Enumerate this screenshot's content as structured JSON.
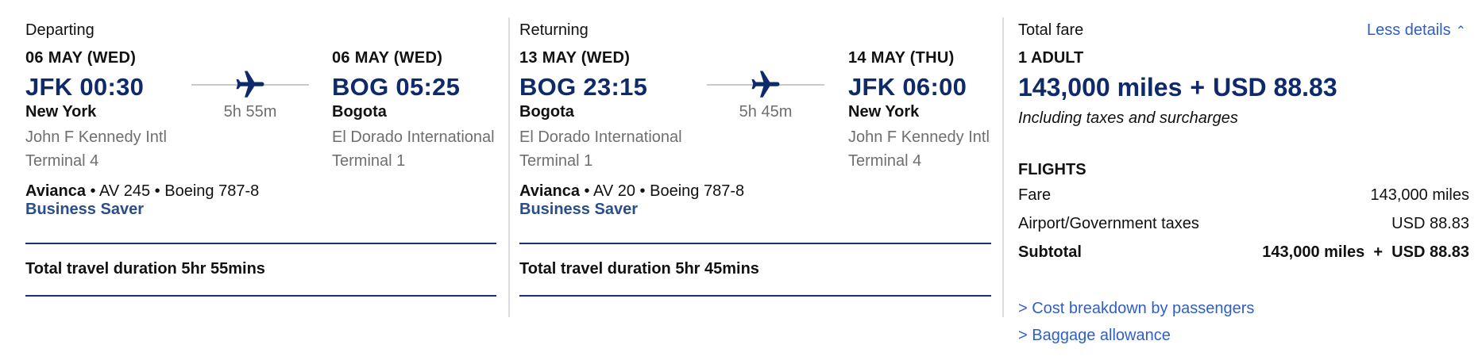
{
  "departing": {
    "section_label": "Departing",
    "from": {
      "date": "06 MAY (WED)",
      "time": "JFK 00:30",
      "city": "New York",
      "airport": "John F Kennedy Intl",
      "terminal": "Terminal 4"
    },
    "to": {
      "date": "06 MAY (WED)",
      "time": "BOG 05:25",
      "city": "Bogota",
      "airport": "El Dorado International",
      "terminal": "Terminal 1"
    },
    "duration": "5h 55m",
    "airline": "Avianca",
    "flight_details": "AV 245 • Boeing 787-8",
    "fare_class": "Business Saver",
    "total_duration": "Total travel duration 5hr 55mins"
  },
  "returning": {
    "section_label": "Returning",
    "from": {
      "date": "13 MAY (WED)",
      "time": "BOG 23:15",
      "city": "Bogota",
      "airport": "El Dorado International",
      "terminal": "Terminal 1"
    },
    "to": {
      "date": "14 MAY (THU)",
      "time": "JFK 06:00",
      "city": "New York",
      "airport": "John F Kennedy Intl",
      "terminal": "Terminal 4"
    },
    "duration": "5h 45m",
    "airline": "Avianca",
    "flight_details": "AV 20 • Boeing 787-8",
    "fare_class": "Business Saver",
    "total_duration": "Total travel duration 5hr 45mins"
  },
  "fare": {
    "title": "Total fare",
    "less_details": "Less details",
    "passengers": "1 ADULT",
    "miles": "143,000 miles",
    "plus": "+",
    "usd": "USD 88.83",
    "includes_note": "Including taxes and surcharges",
    "flights_heading": "FLIGHTS",
    "rows": [
      {
        "label": "Fare",
        "value": "143,000 miles"
      },
      {
        "label": "Airport/Government taxes",
        "value": "USD 88.83"
      },
      {
        "label": "Subtotal",
        "value": "143,000 miles  +  USD 88.83"
      }
    ],
    "cost_breakdown_link": "> Cost breakdown by passengers",
    "baggage_link": "> Baggage allowance"
  },
  "colors": {
    "primary_navy": "#0e2a6b",
    "fare_class_blue": "#2a4f86",
    "link_blue": "#2f5fc6",
    "muted_gray": "#6f6f6f"
  },
  "icons": {
    "plane": "airplane-icon",
    "chevron": "chevron-up-icon"
  }
}
